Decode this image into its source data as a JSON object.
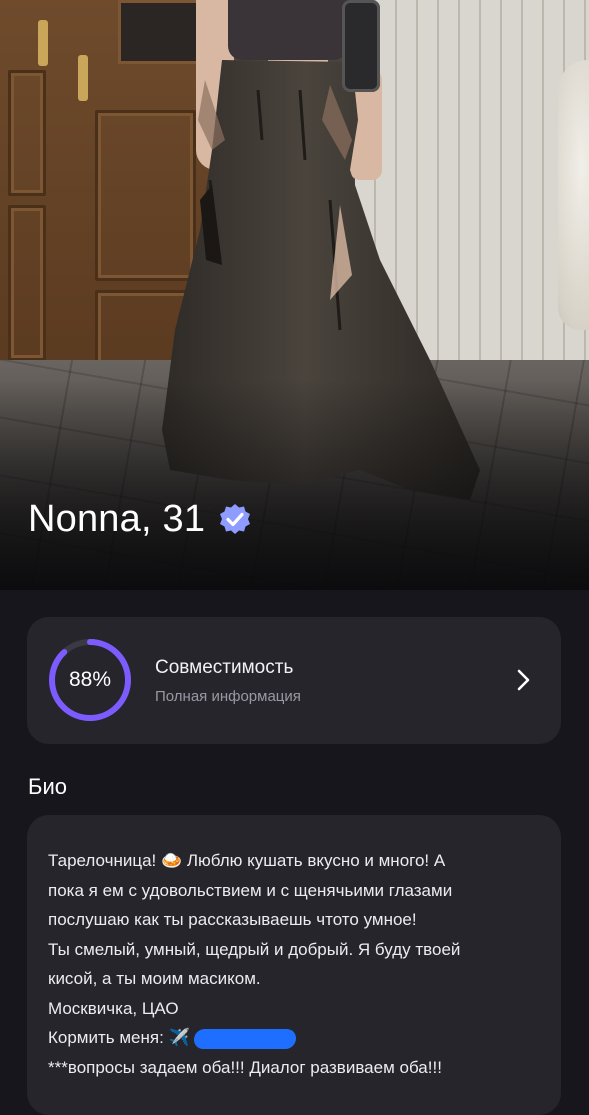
{
  "profile": {
    "name_age": "Nonna, 31",
    "verified": true,
    "accent_color": "#7c5cff",
    "verified_color": "#8f9cff"
  },
  "compatibility": {
    "percent_label": "88%",
    "percent_value": 88,
    "title": "Совместимость",
    "subtitle": "Полная информация"
  },
  "bio": {
    "heading": "Био",
    "lines": [
      "Тарелочница! 🍛 Люблю кушать вкусно и много! А",
      "пока я ем с удовольствием и с щенячьими глазами",
      "послушаю как ты рассказываешь чтото умное!",
      "Ты смелый, умный, щедрый и добрый. Я буду твоей",
      "кисой, а ты моим масиком.",
      "Москвичка, ЦАО",
      "Кормить меня: ✈️",
      "***вопросы задаем оба!!! Диалог развиваем оба!!!"
    ]
  }
}
